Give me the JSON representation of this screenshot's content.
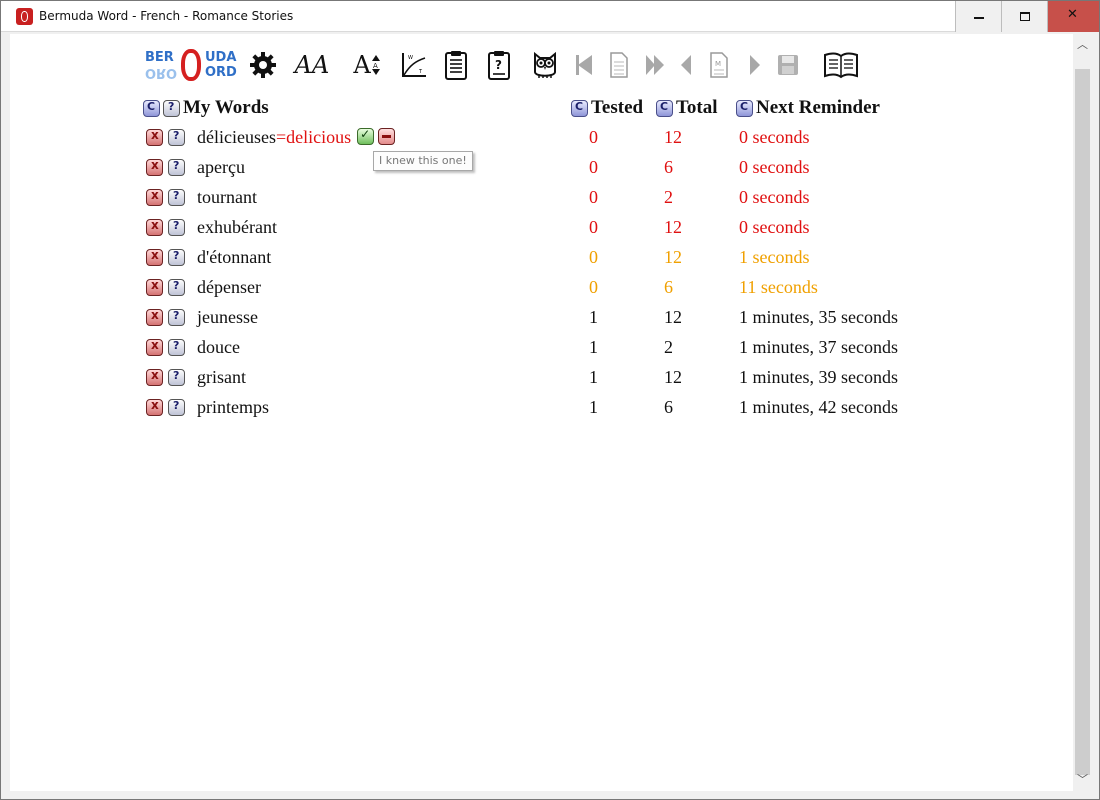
{
  "window": {
    "title": "Bermuda Word - French - Romance Stories",
    "controls": {
      "minimize": "minimize",
      "maximize": "maximize",
      "close": "✕"
    }
  },
  "toolbar": {
    "logo": {
      "top_left": "BER",
      "top_right": "UDA",
      "bottom_left": "ORO",
      "bottom_right": "ORD"
    },
    "icons": [
      "settings-gear-icon",
      "font-icon",
      "font-size-icon",
      "graph-icon",
      "clipboard-list-icon",
      "clipboard-question-icon",
      "owl-icon",
      "first-page-icon",
      "page-icon",
      "fast-forward-icon",
      "previous-icon",
      "page-m-icon",
      "next-icon",
      "save-icon",
      "book-icon"
    ],
    "font_label": "AA",
    "font_size_label": "A"
  },
  "headers": {
    "my_words": "My Words",
    "tested": "Tested",
    "total": "Total",
    "next_reminder": "Next Reminder"
  },
  "tooltip": "I knew this one!",
  "rows": [
    {
      "word": "délicieuses",
      "translation": "=delicious",
      "tested": "0",
      "total": "12",
      "next": "0 seconds",
      "color": "red"
    },
    {
      "word": "aperçu",
      "tested": "0",
      "total": "6",
      "next": "0 seconds",
      "color": "red"
    },
    {
      "word": "tournant",
      "tested": "0",
      "total": "2",
      "next": "0 seconds",
      "color": "red"
    },
    {
      "word": "exhubérant",
      "tested": "0",
      "total": "12",
      "next": "0 seconds",
      "color": "red"
    },
    {
      "word": "d'étonnant",
      "tested": "0",
      "total": "12",
      "next": "1 seconds",
      "color": "orange"
    },
    {
      "word": "dépenser",
      "tested": "0",
      "total": "6",
      "next": "11 seconds",
      "color": "orange"
    },
    {
      "word": "jeunesse",
      "tested": "1",
      "total": "12",
      "next": "1 minutes, 35 seconds",
      "color": "black"
    },
    {
      "word": "douce",
      "tested": "1",
      "total": "2",
      "next": "1 minutes, 37 seconds",
      "color": "black"
    },
    {
      "word": "grisant",
      "tested": "1",
      "total": "12",
      "next": "1 minutes, 39 seconds",
      "color": "black"
    },
    {
      "word": "printemps",
      "tested": "1",
      "total": "6",
      "next": "1 minutes, 42 seconds",
      "color": "black"
    }
  ],
  "colors": {
    "red": "#e01010",
    "orange": "#f0a000",
    "black": "#111111"
  }
}
